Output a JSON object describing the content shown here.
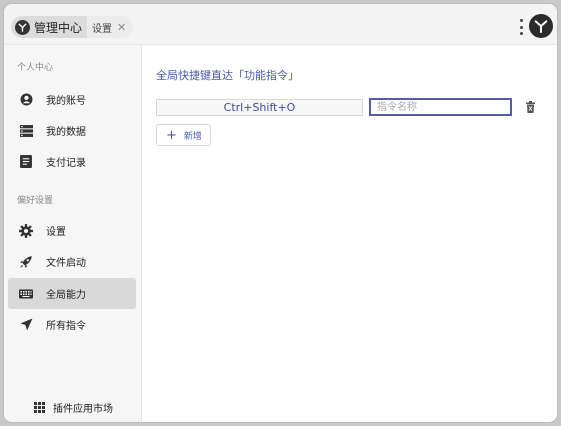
{
  "titlebar": {
    "app_title": "管理中心",
    "current_tab": "设置",
    "close_glyph": "✕",
    "icons": [
      "app-logo-icon",
      "more-options-icon",
      "main-logo-icon"
    ]
  },
  "sidebar": {
    "section_personal": "个人中心",
    "section_preferences": "偏好设置",
    "items": [
      {
        "label": "我的账号",
        "icon": "account-icon"
      },
      {
        "label": "我的数据",
        "icon": "data-icon"
      },
      {
        "label": "支付记录",
        "icon": "payment-record-icon"
      },
      {
        "label": "设置",
        "icon": "gear-icon"
      },
      {
        "label": "文件启动",
        "icon": "rocket-icon"
      },
      {
        "label": "全局能力",
        "icon": "keyboard-icon",
        "active": true
      },
      {
        "label": "所有指令",
        "icon": "send-icon"
      }
    ],
    "market_label": "插件应用市场"
  },
  "main": {
    "title": "全局快捷键直达「功能指令」",
    "hotkey": "Ctrl+Shift+O",
    "command_placeholder": "指令名称",
    "command_value": "",
    "add_label": "新增",
    "add_glyph": "+"
  },
  "colors": {
    "accent": "#4a5aa8",
    "active_nav": "#d9d9d9",
    "sidebar_bg": "#f6f6f6"
  }
}
